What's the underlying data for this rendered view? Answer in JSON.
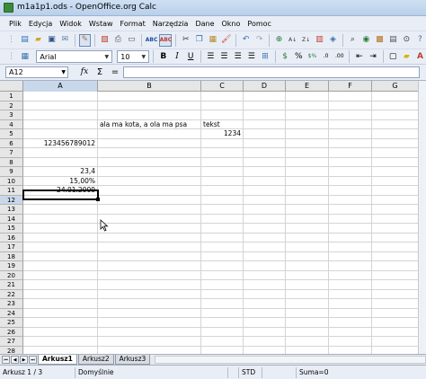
{
  "window": {
    "title": "m1a1p1.ods - OpenOffice.org Calc"
  },
  "menu": [
    "Plik",
    "Edycja",
    "Widok",
    "Wstaw",
    "Format",
    "Narzędzia",
    "Dane",
    "Okno",
    "Pomoc"
  ],
  "format_toolbar": {
    "font_name": "Arial",
    "font_size": "10"
  },
  "formula_bar": {
    "name_box": "A12",
    "content": ""
  },
  "columns": [
    "A",
    "B",
    "C",
    "D",
    "E",
    "F",
    "G"
  ],
  "rows": [
    "1",
    "2",
    "3",
    "4",
    "5",
    "6",
    "7",
    "8",
    "9",
    "10",
    "11",
    "12",
    "13",
    "14",
    "15",
    "16",
    "17",
    "18",
    "19",
    "20",
    "21",
    "22",
    "23",
    "24",
    "25",
    "26",
    "27",
    "28"
  ],
  "cells": {
    "B4": "ala ma kota, a ola ma psa",
    "C4": "tekst",
    "C5": "1234",
    "A6": "123456789012",
    "A9": "23,4",
    "A10": "15,00%",
    "A11": "24.01.2009"
  },
  "active_cell": "A12",
  "sheets": [
    "Arkusz1",
    "Arkusz2",
    "Arkusz3"
  ],
  "active_sheet": "Arkusz1",
  "status": {
    "sheet_position": "Arkusz 1 / 3",
    "page_style": "Domyślnie",
    "mode": "STD",
    "sum": "Suma=0"
  }
}
